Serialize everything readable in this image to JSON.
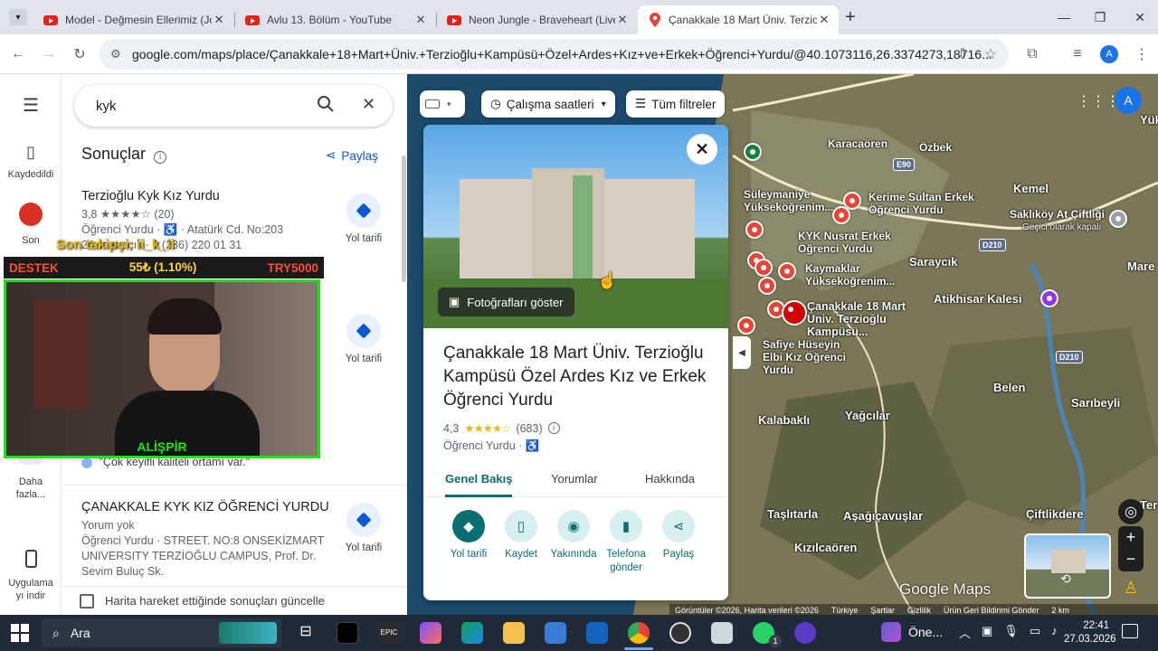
{
  "browser": {
    "tabs": [
      {
        "title": "Model - Değmesin Ellerimiz (Jo",
        "icon": "youtube-icon"
      },
      {
        "title": "Avlu 13. Bölüm - YouTube",
        "icon": "youtube-icon"
      },
      {
        "title": "Neon Jungle - Braveheart (Live",
        "icon": "youtube-icon"
      },
      {
        "title": "Çanakkale 18 Mart Üniv. Terziog",
        "icon": "google-maps-icon"
      }
    ],
    "url": "google.com/maps/place/Çanakkale+18+Mart+Üniv.+Terzioğlu+Kampüsü+Özel+Ardes+Kız+ve+Erkek+Öğrenci+Yurdu/@40.1073116,26.3374273,18716...",
    "profile_initial": "A"
  },
  "rail": {
    "saved": "Kaydedildi",
    "recent": "Son",
    "more": "Daha fazla...",
    "get_app": "Uygulama yı indir"
  },
  "search": {
    "query": "kyk"
  },
  "results": {
    "heading": "Sonuçlar",
    "share": "Paylaş",
    "directions_label": "Yol tarifi",
    "items": [
      {
        "name": "Terzioğlu Kyk Kız Yurdu",
        "rating_line": "3,8 ★★★★☆ (20)",
        "line1": "Öğrenci Yurdu · ♿ · Atatürk Cd. No:203",
        "line2": "24 saat açık · 0 (286) 220 01 31"
      },
      {
        "name": "",
        "rating_line": "",
        "line1": "",
        "line2": "\"Çok keyifli kaliteli ortamı var.\""
      },
      {
        "name": "ÇANAKKALE KYK KIZ ÖĞRENCİ YURDU",
        "rating_line": "Yorum yok",
        "line1": "Öğrenci Yurdu · STREET. NO:8 ONSEKİZMART UNIVERSITY TERZİOĞLU CAMPUS, Prof. Dr. Sevim Buluç Sk.",
        "line2": ""
      }
    ],
    "update_checkbox": "Harita hareket ettiğinde sonuçları güncelle"
  },
  "stream": {
    "follower": "Son takipçi: ii_k_ii",
    "destek": "DESTEK",
    "amount": "55₺ (1.10%)",
    "goal": "TRY5000",
    "cam_name": "ALİŞPİR"
  },
  "map": {
    "chips": {
      "hours": "Çalışma saatleri",
      "filters": "Tüm filtreler"
    },
    "labels": [
      "Karacaören",
      "Özbek",
      "Kemel",
      "Süleymaniye Yükseköğrenim...",
      "Kerime Sultan Erkek Öğrenci Yurdu",
      "KYK Nusrat Erkek Öğrenci Yurdu",
      "Saklıköy At Çiftliği",
      "Geçici olarak kapalı",
      "Kaymaklar Yükseköğrenim...",
      "Saraycık",
      "Çanakkale 18 Mart Üniv. Terzioğlu Kampüsü...",
      "Atikhisar Kalesi",
      "Safiye Hüseyin Elbi Kız Öğrenci Yurdu",
      "Belen",
      "Sarıbeyli",
      "Kalabaklı",
      "Yağcılar",
      "Taşlıtarla",
      "Aşağıçavuşlar",
      "Çiftlikdere",
      "Kızılcaören",
      "Mare",
      "Yük",
      "Ter"
    ],
    "road_shields": [
      "E90",
      "D210",
      "D210"
    ],
    "footer": [
      "Görüntüler ©2026, Harita verileri ©2026",
      "Türkiye",
      "Şartlar",
      "Gizlilik",
      "Ürün Geri Bildirimi Gönder",
      "2 km"
    ],
    "logo": "Google Maps"
  },
  "card": {
    "photo_button": "Fotoğrafları göster",
    "title": "Çanakkale 18 Mart Üniv. Terzioğlu Kampüsü Özel Ardes Kız ve Erkek Öğrenci Yurdu",
    "rating": "4,3",
    "stars": 4.3,
    "review_count": "(683)",
    "category": "Öğrenci Yurdu · ♿",
    "tabs": [
      "Genel Bakış",
      "Yorumlar",
      "Hakkında"
    ],
    "actions": [
      "Yol tarifi",
      "Kaydet",
      "Yakınında",
      "Telefona gönder",
      "Paylaş"
    ]
  },
  "taskbar": {
    "search": "Ara",
    "pinned_app": "Öne...",
    "time": "22:41",
    "date": "27.03.2026",
    "whatsapp_badge": "1"
  }
}
